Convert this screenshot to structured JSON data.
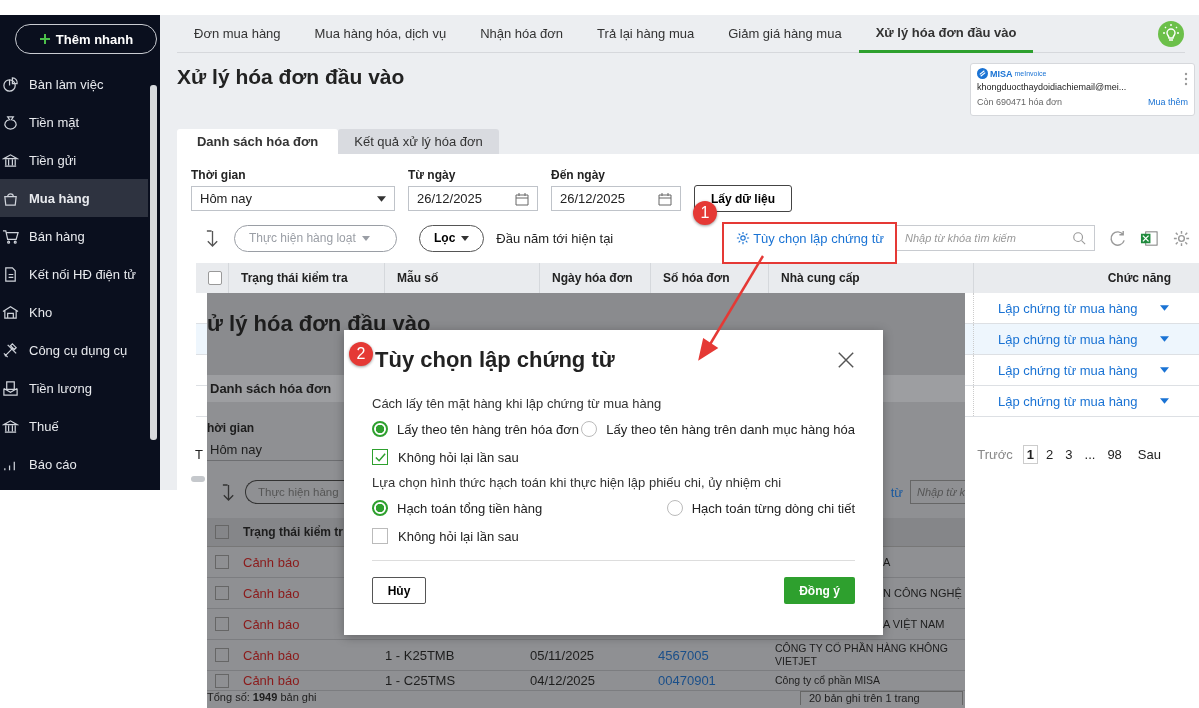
{
  "sidebar": {
    "quick_add": "Thêm nhanh",
    "items": [
      {
        "label": "Bàn làm việc",
        "selected": false
      },
      {
        "label": "Tiền mặt",
        "selected": false
      },
      {
        "label": "Tiền gửi",
        "selected": false
      },
      {
        "label": "Mua hàng",
        "selected": true
      },
      {
        "label": "Bán hàng",
        "selected": false
      },
      {
        "label": "Kết nối HĐ điện tử",
        "selected": false
      },
      {
        "label": "Kho",
        "selected": false
      },
      {
        "label": "Công cụ dụng cụ",
        "selected": false
      },
      {
        "label": "Tiền lương",
        "selected": false
      },
      {
        "label": "Thuế",
        "selected": false
      },
      {
        "label": "Báo cáo",
        "selected": false
      }
    ]
  },
  "module_tabs": [
    {
      "label": "Đơn mua hàng",
      "selected": false
    },
    {
      "label": "Mua hàng hóa, dịch vụ",
      "selected": false
    },
    {
      "label": "Nhận hóa đơn",
      "selected": false
    },
    {
      "label": "Trả lại hàng mua",
      "selected": false
    },
    {
      "label": "Giảm giá hàng mua",
      "selected": false
    },
    {
      "label": "Xử lý hóa đơn đầu vào",
      "selected": true
    }
  ],
  "page_title": "Xử lý hóa đơn đầu vào",
  "invoice_card": {
    "brand": "MISA",
    "brand_suffix": "meInvoice",
    "email": "khongduocthaydoidiachiemail@mei...",
    "remaining": "Còn 690471 hóa đơn",
    "buy_more": "Mua thêm"
  },
  "view_tabs": [
    {
      "label": "Danh sách hóa đơn",
      "selected": true
    },
    {
      "label": "Kết quả xử lý hóa đơn",
      "selected": false
    }
  ],
  "filters": {
    "period_label": "Thời gian",
    "period_value": "Hôm nay",
    "from_label": "Từ ngày",
    "from_value": "26/12/2025",
    "to_label": "Đến ngày",
    "to_value": "26/12/2025",
    "fetch_button": "Lấy dữ liệu"
  },
  "toolbar": {
    "bulk_action": "Thực hiện hàng loạt",
    "filter_button": "Lọc",
    "range_text": "Đầu năm tới hiện tại",
    "options_link": "Tùy chọn lập chứng từ",
    "search_placeholder": "Nhập từ khóa tìm kiếm"
  },
  "table": {
    "columns": [
      "Trạng thái kiểm tra",
      "Mẫu số",
      "Ngày hóa đơn",
      "Số hóa đơn",
      "Nhà cung cấp",
      "Chức năng"
    ],
    "all_checked": false,
    "rows": [
      {
        "action": "Lập chứng từ mua hàng",
        "hovered": false
      },
      {
        "action": "Lập chứng từ mua hàng",
        "hovered": true
      },
      {
        "action": "Lập chứng từ mua hàng",
        "hovered": false
      },
      {
        "action": "Lập chứng từ mua hàng",
        "hovered": false
      }
    ]
  },
  "footer_fragment": "T",
  "pagination": {
    "previous": "Trước",
    "pages": [
      {
        "label": "1",
        "selected": true
      },
      {
        "label": "2",
        "selected": false
      },
      {
        "label": "3",
        "selected": false
      },
      {
        "label": "...",
        "selected": false
      },
      {
        "label": "98",
        "selected": false
      }
    ],
    "next": "Sau"
  },
  "overlay_screenshot": {
    "title": "ử lý hóa đơn đầu vào",
    "tab": "Danh sách hóa đơn",
    "period_label": "hời gian",
    "period_value": "Hôm nay",
    "bulk_action": "Thực hiện hàng",
    "options_link": "từ",
    "search_placeholder": "Nhập từ k",
    "status_column": "Trạng thái kiểm tr",
    "all_checked": false,
    "rows": [
      {
        "kind": "covered",
        "checked": false,
        "status": "Cảnh báo",
        "supplier": "A"
      },
      {
        "kind": "covered",
        "checked": false,
        "status": "Cảnh báo",
        "supplier": "N CÔNG NGHỆ"
      },
      {
        "kind": "covered",
        "checked": false,
        "status": "Cảnh báo",
        "supplier": "A VIỆT NAM"
      },
      {
        "kind": "full",
        "checked": false,
        "status": "Cảnh báo",
        "template": "1 - K25TMB",
        "date": "05/11/2025",
        "number": "4567005",
        "supplier": "CÔNG TY CỔ PHẦN HÀNG KHÔNG VIETJET"
      },
      {
        "kind": "full",
        "checked": false,
        "status": "Cảnh báo",
        "template": "1 - C25TMS",
        "date": "04/12/2025",
        "number": "00470901",
        "supplier": "Công ty cổ phần MISA"
      }
    ],
    "total": "Tổng số: **1949** bản ghi",
    "page_size": "20 bản ghi trên 1 trang"
  },
  "dialog": {
    "title": "Tùy chọn lập chứng từ",
    "sections": [
      {
        "label": "Cách lấy tên mặt hàng khi lập chứng từ mua hàng",
        "options": [
          {
            "label": "Lấy theo tên hàng trên hóa đơn",
            "selected": true
          },
          {
            "label": "Lấy theo tên hàng trên danh mục hàng hóa",
            "selected": false
          }
        ],
        "dont_ask": {
          "label": "Không hỏi lại lần sau",
          "checked": true
        }
      },
      {
        "label": "Lựa chọn hình thức hạch toán khi thực hiện lập phiếu chi, ủy nhiệm chi",
        "options": [
          {
            "label": "Hạch toán tổng tiền hàng",
            "selected": true
          },
          {
            "label": "Hạch toán từng dòng chi tiết",
            "selected": false
          }
        ],
        "dont_ask": {
          "label": "Không hỏi lại lần sau",
          "checked": false
        }
      }
    ],
    "cancel": "Hủy",
    "confirm": "Đồng ý"
  },
  "annotations": {
    "markers": [
      "1",
      "2"
    ]
  }
}
